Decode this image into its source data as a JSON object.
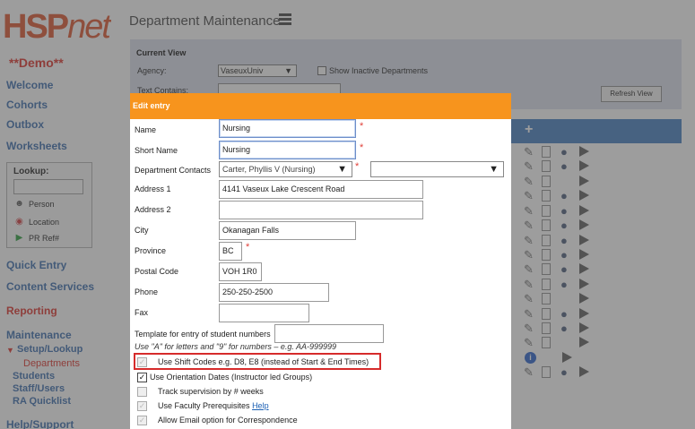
{
  "app": {
    "logo_hsp": "HSP",
    "logo_net": "net",
    "demo": "**Demo**"
  },
  "sidebar": {
    "welcome": "Welcome",
    "cohorts": "Cohorts",
    "outbox": "Outbox",
    "worksheets": "Worksheets",
    "lookup": {
      "title": "Lookup:",
      "person": "Person",
      "location": "Location",
      "pr_ref": "PR Ref#"
    },
    "quick_entry": "Quick Entry",
    "content_services": "Content Services",
    "reporting": "Reporting",
    "maintenance": "Maintenance",
    "setup_lookup": "Setup/Lookup",
    "departments": "Departments",
    "students": "Students",
    "staff_users": "Staff/Users",
    "ra_quicklist": "RA Quicklist",
    "help_support": "Help/Support"
  },
  "main": {
    "page_title": "Department Maintenance",
    "current_view": {
      "title": "Current View",
      "agency_label": "Agency:",
      "agency_value": "VaseuxUniv",
      "show_inactive_label": "Show Inactive Departments",
      "text_contains_label": "Text Contains:",
      "refresh_label": "Refresh View"
    },
    "table_plus": "+"
  },
  "modal": {
    "title": "Edit entry",
    "fields": {
      "name_label": "Name",
      "name_value": "Nursing",
      "short_name_label": "Short Name",
      "short_name_value": "Nursing",
      "contacts_label": "Department Contacts",
      "contacts_value": "Carter, Phyllis V (Nursing)",
      "address1_label": "Address 1",
      "address1_value": "4141 Vaseux Lake Crescent Road",
      "address2_label": "Address 2",
      "address2_value": "",
      "city_label": "City",
      "city_value": "Okanagan Falls",
      "province_label": "Province",
      "province_value": "BC",
      "postal_label": "Postal Code",
      "postal_value": "VOH 1R0",
      "phone_label": "Phone",
      "phone_value": "250-250-2500",
      "fax_label": "Fax",
      "fax_value": "",
      "template_label": "Template for entry of student numbers",
      "template_value": "",
      "template_hint": "Use \"A\" for letters and \"9\" for numbers – e.g. AA-999999",
      "required_mark": "*"
    },
    "checkboxes": {
      "shift_codes": "Use Shift Codes e.g. D8, E8 (instead of Start & End Times)",
      "orientation": "Use Orientation Dates (Instructor led Groups)",
      "supervision": "Track supervision by # weeks",
      "faculty_prereq": "Use Faculty Prerequisites",
      "faculty_help": "Help",
      "email_option": "Allow Email option for Correspondence"
    }
  }
}
